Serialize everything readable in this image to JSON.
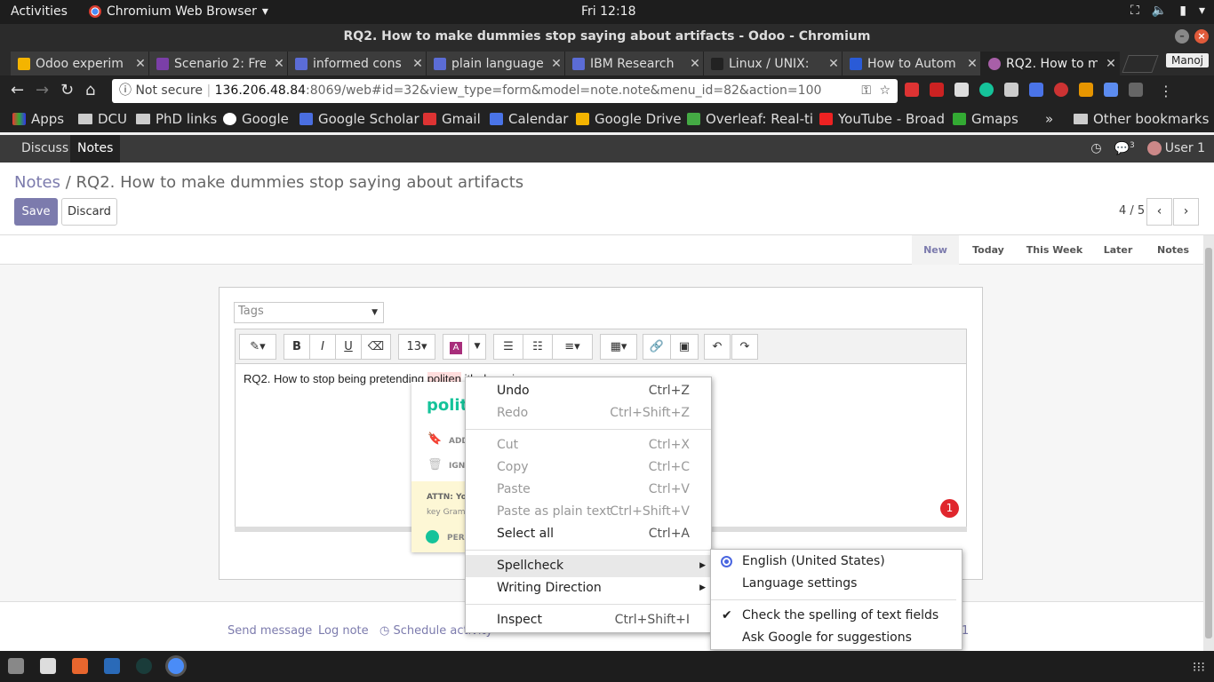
{
  "gnome": {
    "activities": "Activities",
    "app_name": "Chromium Web Browser",
    "clock": "Fri 12:18"
  },
  "window": {
    "title": "RQ2. How to make dummies stop saying about artifacts - Odoo - Chromium"
  },
  "tabs": [
    {
      "label": "Odoo experim",
      "color": "#f4b400"
    },
    {
      "label": "Scenario 2: Fre",
      "color": "#7b3fa8"
    },
    {
      "label": "informed cons",
      "color": "#5b6cd6"
    },
    {
      "label": "plain language",
      "color": "#5b6cd6"
    },
    {
      "label": "IBM Research",
      "color": "#5b6cd6"
    },
    {
      "label": "Linux / UNIX:",
      "color": "#222222"
    },
    {
      "label": "How to Autom",
      "color": "#2a5bd7"
    },
    {
      "label": "RQ2. How to m",
      "color": "#a85fa8"
    }
  ],
  "profile": "Manoj",
  "omnibox": {
    "security": "Not secure",
    "host": "136.206.48.84",
    "path": ":8069/web#id=32&view_type=form&model=note.note&menu_id=82&action=100"
  },
  "bookmarks": [
    {
      "label": "Apps"
    },
    {
      "label": "DCU"
    },
    {
      "label": "PhD links"
    },
    {
      "label": "Google"
    },
    {
      "label": "Google Scholar"
    },
    {
      "label": "Gmail"
    },
    {
      "label": "Calendar"
    },
    {
      "label": "Google Drive"
    },
    {
      "label": "Overleaf: Real-ti"
    },
    {
      "label": "YouTube - Broad"
    },
    {
      "label": "Gmaps"
    },
    {
      "label": "»"
    },
    {
      "label": "Other bookmarks"
    }
  ],
  "odoo_nav": {
    "discuss": "Discuss",
    "notes": "Notes",
    "message_count": "3",
    "user": "User 1"
  },
  "breadcrumb": {
    "root": "Notes",
    "separator": "/",
    "current": "RQ2. How to make dummies stop saying about artifacts"
  },
  "actions": {
    "save": "Save",
    "discard": "Discard"
  },
  "pager": {
    "label": "4 / 5",
    "prev": "‹",
    "next": "›"
  },
  "stages": [
    "New",
    "Today",
    "This Week",
    "Later",
    "Notes"
  ],
  "tags_placeholder": "Tags",
  "editor": {
    "font_size": "13",
    "text_before": "RQ2. How to stop being pretending ",
    "misspelled": "politen",
    "text_after": "      ith dummies"
  },
  "grammarly": {
    "suggestion": "polit",
    "add": "ADD",
    "ignore": "IGN",
    "attn_title": "ATTN: Yo",
    "attn_body": "key Gram",
    "per": "PER",
    "badge": "1"
  },
  "chatter": {
    "send": "Send message",
    "log": "Log note",
    "schedule": "Schedule activity",
    "follower_count": "1"
  },
  "context_menu": [
    {
      "label": "Undo",
      "shortcut": "Ctrl+Z",
      "disabled": false
    },
    {
      "label": "Redo",
      "shortcut": "Ctrl+Shift+Z",
      "disabled": true
    },
    {
      "label": "Cut",
      "shortcut": "Ctrl+X",
      "disabled": true
    },
    {
      "label": "Copy",
      "shortcut": "Ctrl+C",
      "disabled": true
    },
    {
      "label": "Paste",
      "shortcut": "Ctrl+V",
      "disabled": true
    },
    {
      "label": "Paste as plain text",
      "shortcut": "Ctrl+Shift+V",
      "disabled": true
    },
    {
      "label": "Select all",
      "shortcut": "Ctrl+A",
      "disabled": false
    },
    {
      "label": "Spellcheck",
      "shortcut": "",
      "disabled": false
    },
    {
      "label": "Writing Direction",
      "shortcut": "",
      "disabled": false
    },
    {
      "label": "Inspect",
      "shortcut": "Ctrl+Shift+I",
      "disabled": false
    }
  ],
  "spellcheck_menu": [
    {
      "label": "English (United States)"
    },
    {
      "label": "Language settings"
    },
    {
      "label": "Check the spelling of text fields"
    },
    {
      "label": "Ask Google for suggestions"
    }
  ]
}
